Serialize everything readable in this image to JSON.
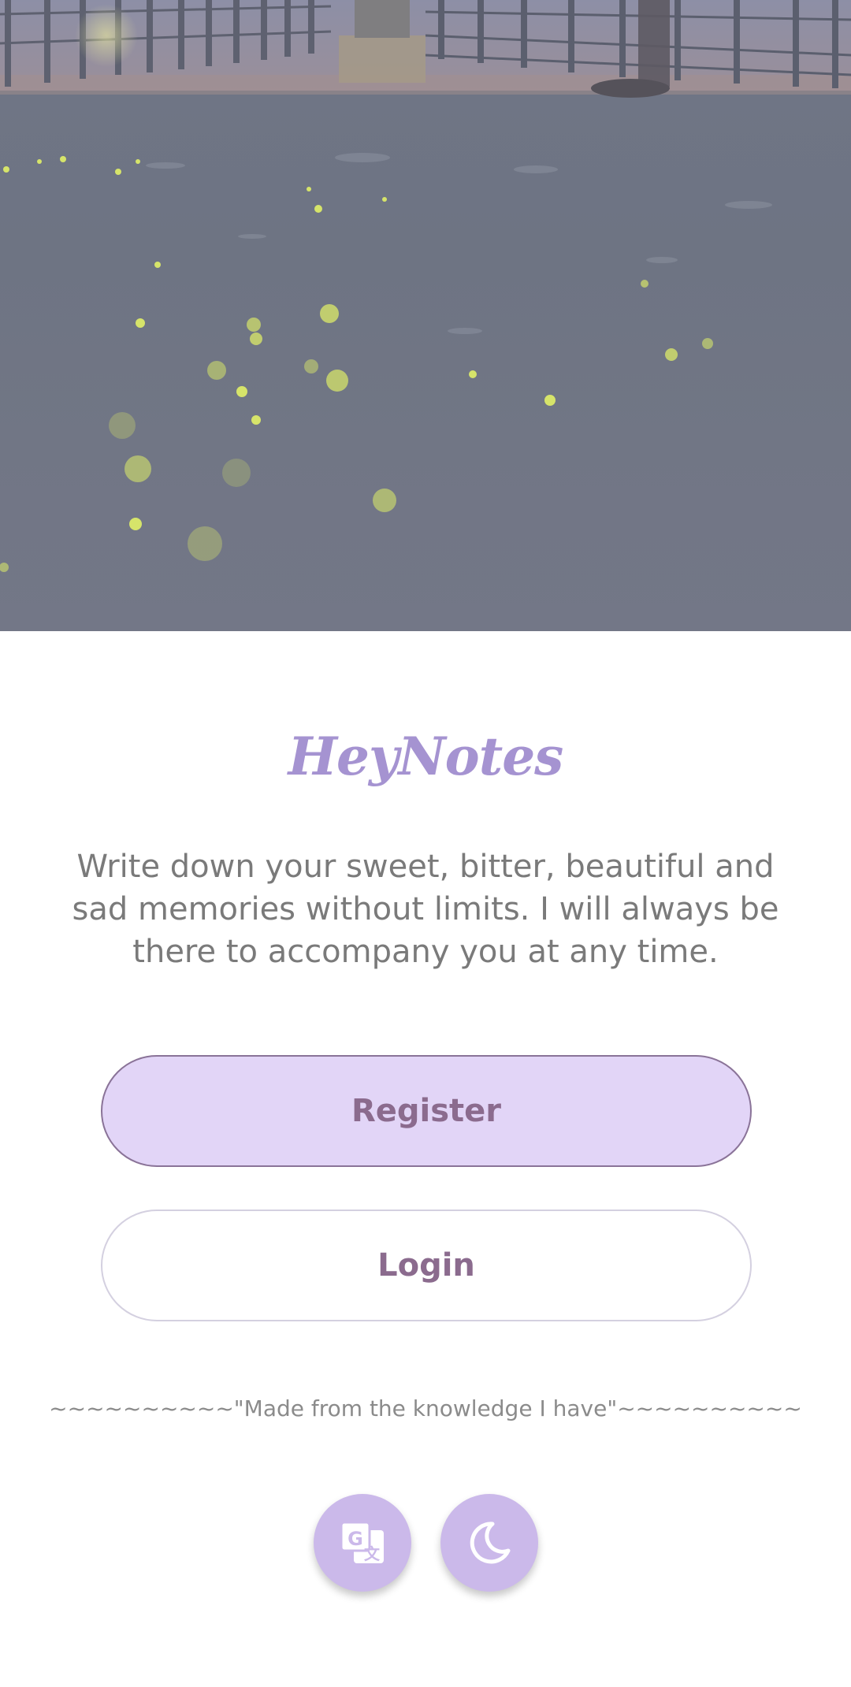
{
  "app": {
    "title": "HeyNotes",
    "tagline": "Write down your sweet, bitter, beautiful and sad memories without limits. I will always be there to accompany you at any time."
  },
  "actions": {
    "register_label": "Register",
    "login_label": "Login"
  },
  "footer": {
    "quote": "~~~~~~~~~~\"Made from the knowledge I have\"~~~~~~~~~~"
  },
  "controls": {
    "translate_icon": "translate-icon",
    "theme_icon": "moon-icon"
  },
  "colors": {
    "accent": "#a593d1",
    "register_background": "#e2d5f7",
    "button_text": "#8b6b8e",
    "round_button": "#cbb9ea"
  }
}
